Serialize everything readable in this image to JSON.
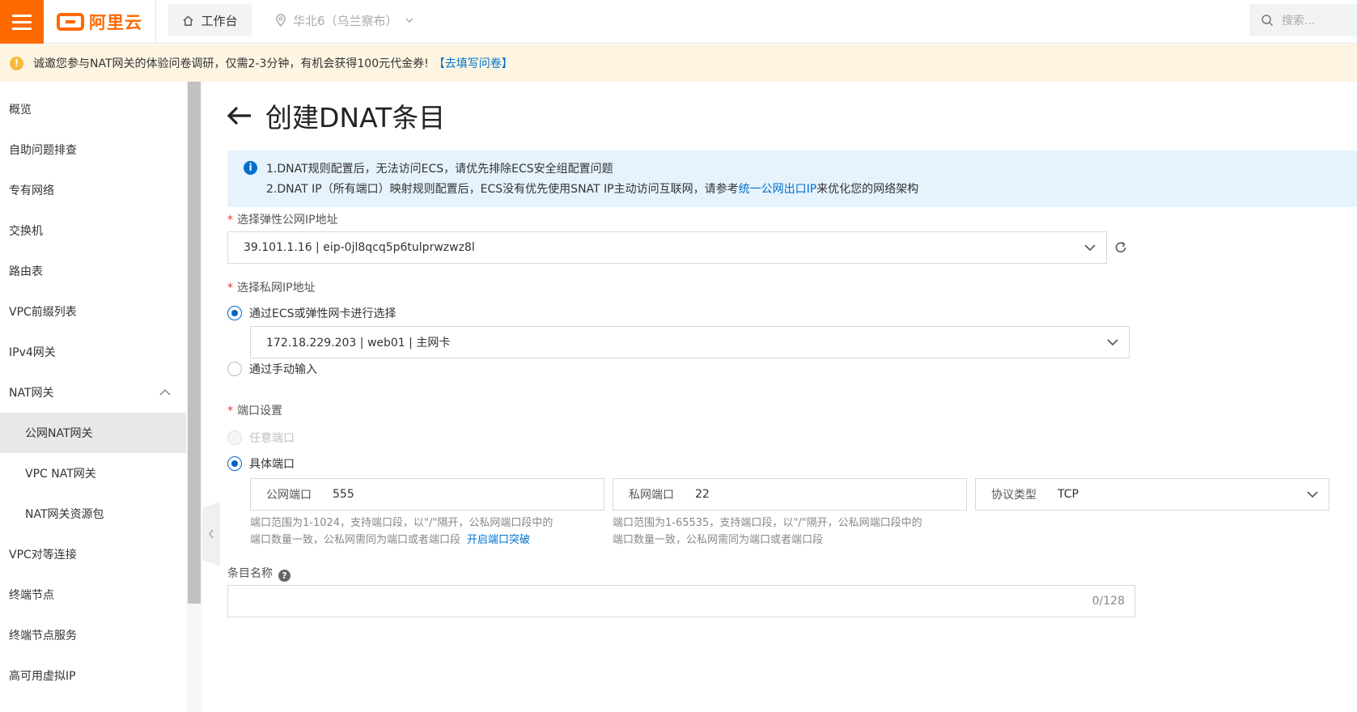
{
  "header": {
    "logo_text": "阿里云",
    "workbench_label": "工作台",
    "region_label": "华北6（乌兰察布）",
    "search_placeholder": "搜索..."
  },
  "notice": {
    "text": "诚邀您参与NAT网关的体验问卷调研，仅需2-3分钟，有机会获得100元代金券!",
    "link": "【去填写问卷】"
  },
  "sidebar": {
    "items": [
      {
        "label": "概览"
      },
      {
        "label": "自助问题排查"
      },
      {
        "label": "专有网络"
      },
      {
        "label": "交换机"
      },
      {
        "label": "路由表"
      },
      {
        "label": "VPC前缀列表"
      },
      {
        "label": "IPv4网关"
      },
      {
        "label": "NAT网关"
      },
      {
        "label": "公网NAT网关"
      },
      {
        "label": "VPC NAT网关"
      },
      {
        "label": "NAT网关资源包"
      },
      {
        "label": "VPC对等连接"
      },
      {
        "label": "终端节点"
      },
      {
        "label": "终端节点服务"
      },
      {
        "label": "高可用虚拟IP"
      }
    ]
  },
  "page": {
    "title": "创建DNAT条目",
    "info_line1": "1.DNAT规则配置后，无法访问ECS，请优先排除ECS安全组配置问题",
    "info_line2_pre": "2.DNAT IP（所有端口）映射规则配置后，ECS没有优先使用SNAT IP主动访问互联网，请参考",
    "info_line2_link": "统一公网出口IP",
    "info_line2_post": "来优化您的网络架构"
  },
  "form": {
    "eip_label": "选择弹性公网IP地址",
    "eip_value": "39.101.1.16 | eip-0jl8qcq5p6tulprwzwz8l",
    "private_ip_label": "选择私网IP地址",
    "radio_ecs": "通过ECS或弹性网卡进行选择",
    "ecs_value": "172.18.229.203 | web01 | 主网卡",
    "radio_manual": "通过手动输入",
    "port_label": "端口设置",
    "radio_any_port": "任意端口",
    "radio_specific_port": "具体端口",
    "public_port_label": "公网端口",
    "public_port_value": "555",
    "private_port_label": "私网端口",
    "private_port_value": "22",
    "protocol_label": "协议类型",
    "protocol_value": "TCP",
    "public_hint_line1": "端口范围为1-1024，支持端口段，以\"/\"隔开，公私网端口段中的",
    "public_hint_line2": "端口数量一致，公私网需同为端口或者端口段",
    "public_hint_link": "开启端口突破",
    "private_hint_line1": "端口范围为1-65535，支持端口段，以\"/\"隔开，公私网端口段中的",
    "private_hint_line2": "端口数量一致，公私网需同为端口或者端口段",
    "name_label": "条目名称",
    "name_counter": "0/128"
  }
}
